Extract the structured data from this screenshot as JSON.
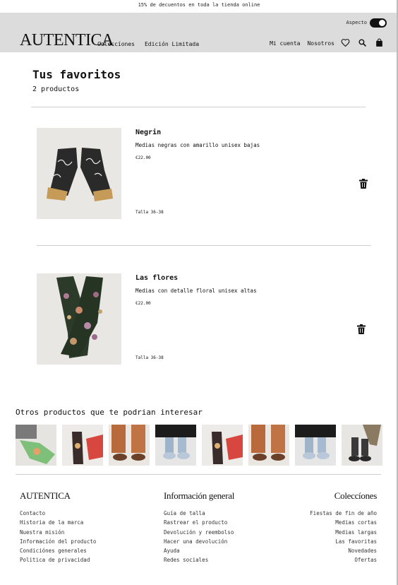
{
  "promo": {
    "text": "15% de decuentos en toda la tienda online"
  },
  "header": {
    "aspect_label": "Aspecto",
    "logo": "AUTENTICA",
    "nav_left": [
      "Coleccíones",
      "Edición Limitada"
    ],
    "nav_right": [
      "Mi cuenta",
      "Nosotros"
    ],
    "icons": [
      "heart-icon",
      "search-icon",
      "shopping-bag-icon"
    ]
  },
  "favorites": {
    "title": "Tus favoritos",
    "count": "2 productos",
    "items": [
      {
        "name": "Negrin",
        "description": "Medias negras con amarillo unisex bajas",
        "price": "€22.00",
        "size": "Talla 36-38"
      },
      {
        "name": "Las flores",
        "description": "Medias con detalle floral unisex altas",
        "price": "€22.00",
        "size": "Talla 36-38"
      }
    ]
  },
  "others": {
    "title": "Otros productos que te podrian interesar"
  },
  "footer": {
    "col1": {
      "title": "AUTENTICA",
      "links": [
        "Contacto",
        "Historia de la marca",
        "Nuestra misión",
        "Información del producto",
        "Condiciónes generales",
        "Politica de privacidad"
      ]
    },
    "col2": {
      "title": "Información general",
      "links": [
        "Guía de talla",
        "Rastrear el producto",
        "Devolución y reembolso",
        "Hacer una devolución",
        "Ayuda",
        "Redes sociales"
      ]
    },
    "col3": {
      "title": "Coleccíones",
      "links": [
        "Fiestas de fin de año",
        "Medias cortas",
        "Medias largas",
        "Las favoritas",
        "Novedades",
        "Ofertas"
      ]
    }
  }
}
